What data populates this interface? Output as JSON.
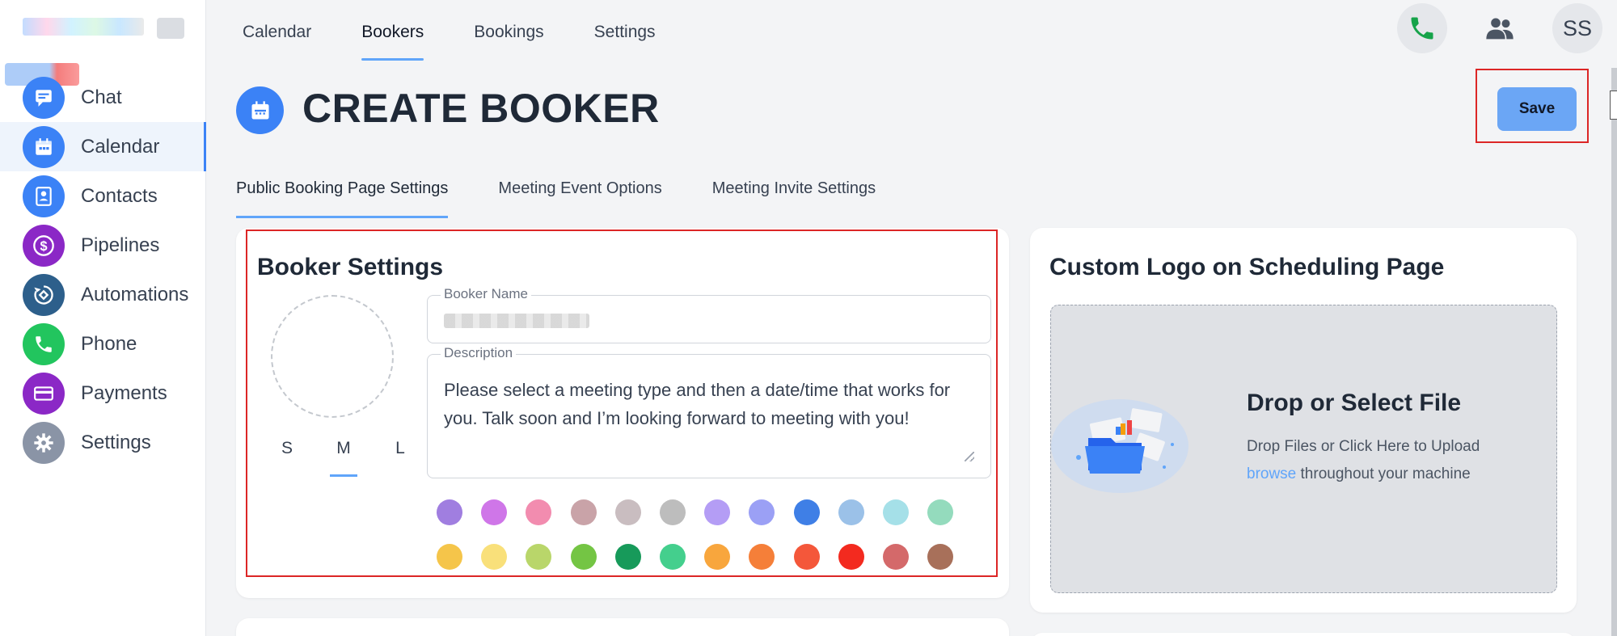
{
  "sidebar": {
    "items": [
      {
        "label": "Chat",
        "icon": "chat-icon",
        "color": "#3b82f6"
      },
      {
        "label": "Calendar",
        "icon": "calendar-icon",
        "color": "#3b82f6"
      },
      {
        "label": "Contacts",
        "icon": "contacts-icon",
        "color": "#3b82f6"
      },
      {
        "label": "Pipelines",
        "icon": "dollar-icon",
        "color": "#8b28c6"
      },
      {
        "label": "Automations",
        "icon": "automations-icon",
        "color": "#2d5f8b"
      },
      {
        "label": "Phone",
        "icon": "phone-icon",
        "color": "#22c55e"
      },
      {
        "label": "Payments",
        "icon": "card-icon",
        "color": "#8b28c6"
      },
      {
        "label": "Settings",
        "icon": "gear-icon",
        "color": "#8a94a6"
      }
    ],
    "active_index": 1
  },
  "topnav": {
    "tabs": [
      "Calendar",
      "Bookers",
      "Bookings",
      "Settings"
    ],
    "active_index": 1,
    "user_initials": "SS"
  },
  "page": {
    "title": "CREATE BOOKER",
    "save_label": "Save"
  },
  "subtabs": {
    "items": [
      "Public Booking Page Settings",
      "Meeting Event Options",
      "Meeting Invite Settings"
    ],
    "active_index": 0
  },
  "booker_settings": {
    "heading": "Booker Settings",
    "sizes": [
      "S",
      "M",
      "L"
    ],
    "active_size": "M",
    "name_label": "Booker Name",
    "description_label": "Description",
    "description_value": "Please select a meeting type and then a date/time that works for you. Talk soon and I’m looking forward to meeting with you!",
    "colors": [
      "#a07ee0",
      "#cf76e8",
      "#f28caf",
      "#c9a3a8",
      "#c9bdc0",
      "#bdbdbd",
      "#b49df5",
      "#9ba0f5",
      "#3f7fe6",
      "#9bc1e8",
      "#a5e0e8",
      "#94dbbd",
      "#f5c54a",
      "#f9e07a",
      "#b9d66a",
      "#74c544",
      "#179a5a",
      "#44cf8d",
      "#f8a63d",
      "#f57f39",
      "#f4573a",
      "#f32a1f",
      "#d4696a",
      "#a8705a"
    ]
  },
  "custom_logo": {
    "heading": "Custom Logo on Scheduling Page",
    "drop_title": "Drop or Select File",
    "drop_text_before": "Drop Files or Click Here to Upload ",
    "drop_link": "browse",
    "drop_text_after": " throughout your machine"
  }
}
